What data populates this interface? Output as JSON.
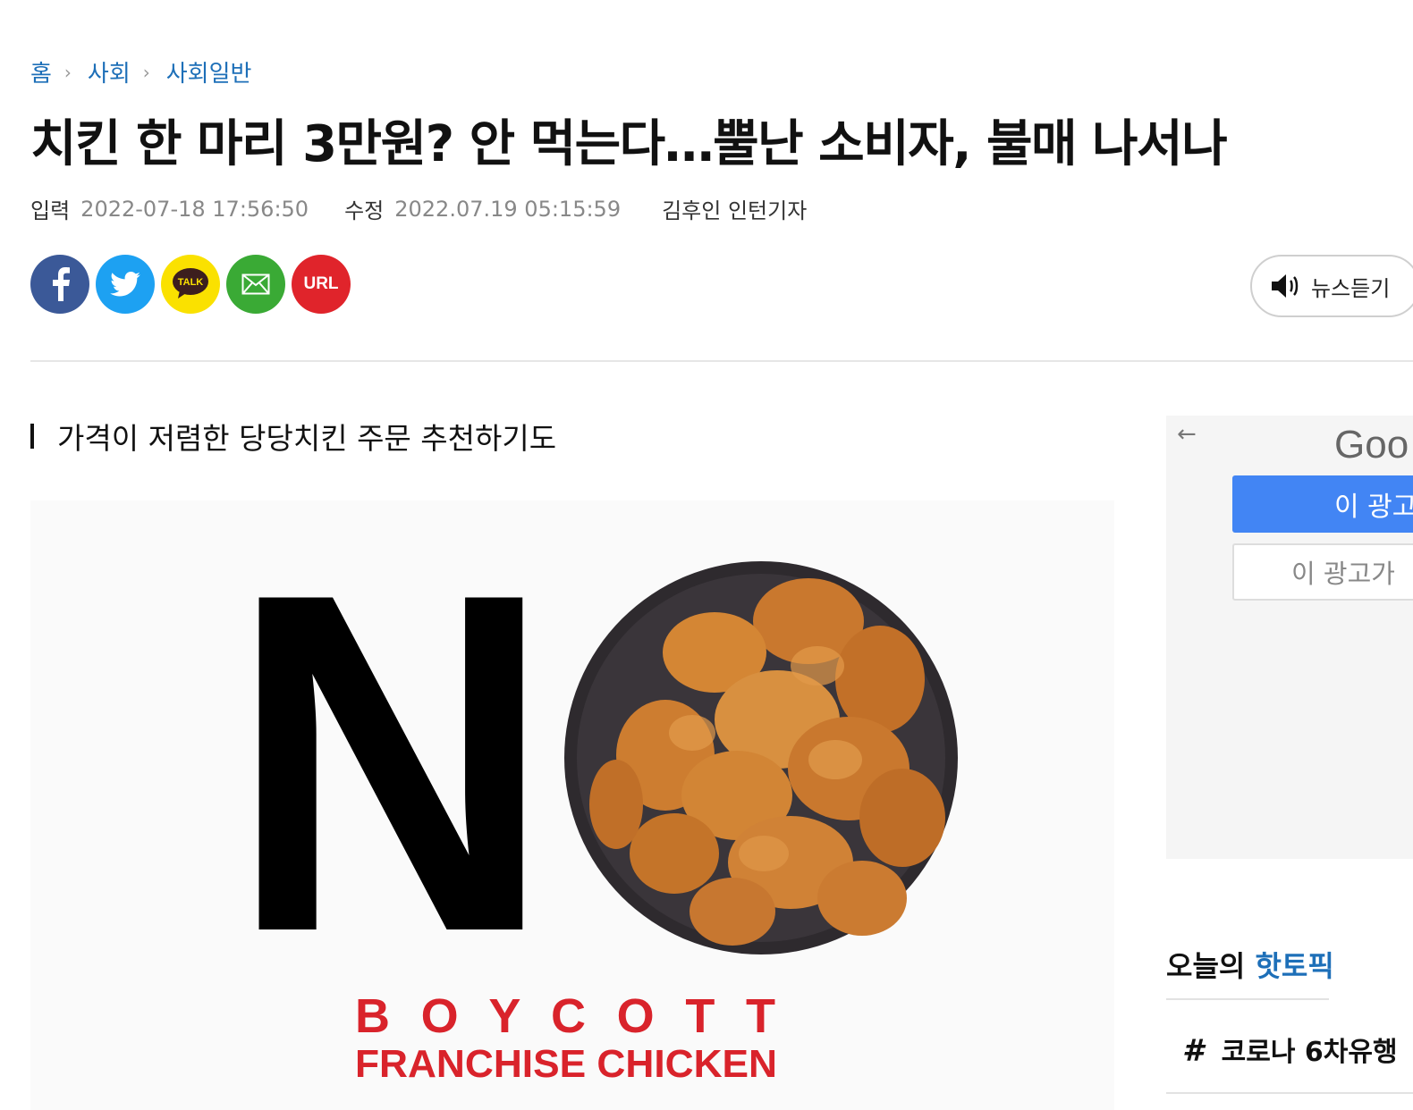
{
  "breadcrumb": {
    "items": [
      "홈",
      "사회",
      "사회일반"
    ]
  },
  "article": {
    "headline": "치킨 한 마리 3만원? 안 먹는다…뿔난 소비자, 불매 나서나",
    "input_label": "입력",
    "input_time": "2022-07-18 17:56:50",
    "modified_label": "수정",
    "modified_time": "2022.07.19 05:15:59",
    "reporter": "김후인 인턴기자",
    "subheading": "가격이 저렴한 당당치킨 주문 추천하기도"
  },
  "share": {
    "kakao_label": "TALK",
    "url_label": "URL",
    "icons": [
      "facebook-icon",
      "twitter-icon",
      "kakaotalk-icon",
      "mail-icon",
      "url-icon"
    ]
  },
  "listen": {
    "label": "뉴스듣기",
    "icon": "speaker-icon"
  },
  "photo": {
    "big_letter": "N",
    "line1": "B O Y C O T T",
    "line2": "FRANCHISE CHICKEN"
  },
  "ad": {
    "back_glyph": "←",
    "brand": "Goo",
    "primary_label": "이 광고",
    "secondary_label": "이 광고가"
  },
  "hot_topics": {
    "title_prefix": "오늘의 ",
    "title_accent": "핫토픽",
    "items": [
      {
        "hash": "#",
        "label": "코로나 6차유행"
      }
    ]
  },
  "colors": {
    "link_blue": "#1d6fb8",
    "facebook": "#3b5998",
    "twitter": "#1da1f2",
    "kakao": "#fae100",
    "mail": "#3aaa35",
    "url": "#e0242b",
    "ad_blue": "#4285f4",
    "boycott_red": "#d9232b"
  }
}
